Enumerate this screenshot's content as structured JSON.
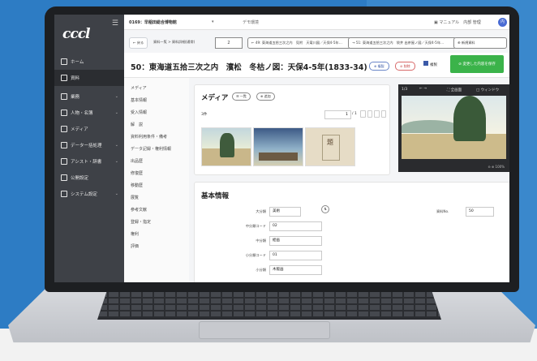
{
  "topbar": {
    "title": "0169：早稲田総合博物館",
    "dropdown": "▾",
    "subtitle": "デモ環境",
    "manual": "マニュアル",
    "user_menu": "内部 管理",
    "avatar_initial": "内"
  },
  "sidebar": {
    "logo": "cccl",
    "items": [
      {
        "label": "ホーム",
        "has_caret": false,
        "active": false
      },
      {
        "label": "資料",
        "has_caret": false,
        "active": true
      },
      {
        "label": "業務",
        "has_caret": true,
        "active": false
      },
      {
        "label": "人物・名簿",
        "has_caret": true,
        "active": false
      },
      {
        "label": "メディア",
        "has_caret": false,
        "active": false
      },
      {
        "label": "データー括処理",
        "has_caret": true,
        "active": false
      },
      {
        "label": "アシスト・辞書",
        "has_caret": true,
        "active": false
      },
      {
        "label": "公開設定",
        "has_caret": false,
        "active": false
      },
      {
        "label": "システム設定",
        "has_caret": true,
        "active": false
      }
    ]
  },
  "toolbar": {
    "back": "← 戻る",
    "breadcrumb": "資料一覧 > 資料詳細(通常)",
    "record_number": "2",
    "prev": "← 49: 東海道五拾三次之内　見附　天竜川図／天保4-5年…",
    "next": "→ 51: 東海道五拾三次之内　袋井 出茶屋ノ図／天保4-5年…",
    "new": "⊕ 新規資料"
  },
  "record": {
    "title": "50：東海道五拾三次之内　濱松　冬枯ノ図：天保4-5年(1833-34)",
    "copy_label": "⊕ 複製",
    "delete_label": "⊘ 削除",
    "revision_label": "複製",
    "save_label": "変更した内容を保存"
  },
  "subnav": [
    "メディア",
    "基本情報",
    "受入情報",
    "解　説",
    "資料利用条件・備考",
    "データ記録・権利情報",
    "出品歴",
    "修復歴",
    "移動歴",
    "展覧",
    "参考文献",
    "登録・指定",
    "権利",
    "評価"
  ],
  "media": {
    "heading": "メディア",
    "list_button": "☰ 一覧",
    "add_button": "⊕ 追加",
    "count": "3件",
    "page_current": "1",
    "page_total": "/ 1"
  },
  "viewer": {
    "page": "1/3",
    "nav": "←  →",
    "fit": "⛶ 全画面",
    "window": "□ ウィンドウ",
    "zoom": "⊖ ⊕ 100%"
  },
  "basic": {
    "heading": "基本情報",
    "fields": [
      {
        "label": "大分類",
        "value": "美術"
      },
      {
        "label": "中分類コード",
        "value": "02"
      },
      {
        "label": "中分類",
        "value": "絵画"
      },
      {
        "label": "小分類コード",
        "value": "01"
      },
      {
        "label": "小分類",
        "value": "木版画"
      }
    ],
    "right_label": "資料No.",
    "right_value": "50"
  }
}
